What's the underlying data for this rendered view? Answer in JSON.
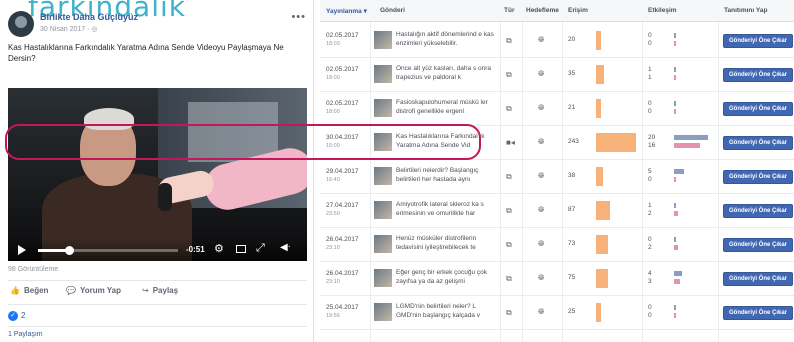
{
  "watermark": "farkındalık",
  "post": {
    "page_name": "Birlikte Daha Güçlüyüz",
    "date": "30 Nisan 2017 · ◎",
    "more": "•••",
    "text": "Kas Hastalıklarına Farkındalık Yaratma Adına Sende Videoyu Paylaşmaya Ne Dersin?",
    "video": {
      "time": "-0:51",
      "progress": 0.22,
      "icons": [
        "play-icon",
        "settings-icon",
        "screen-icon",
        "fullscreen-icon",
        "volume-icon"
      ]
    },
    "views": "98 Görüntüleme",
    "actions": [
      {
        "icon": "👍",
        "label": "Beğen"
      },
      {
        "icon": "💬",
        "label": "Yorum Yap"
      },
      {
        "icon": "↪",
        "label": "Paylaş"
      }
    ],
    "reactions_count": "2",
    "shares": "1 Paylaşım"
  },
  "insights": {
    "headers": {
      "date": "Yayınlanma ▾",
      "post": "Gönderi",
      "type": "Tür",
      "targeting": "Hedefleme",
      "reach": "Erişim",
      "engagement": "Etkileşim",
      "promote": "Tanıtımını Yap"
    },
    "rows": [
      {
        "date": "02.05.2017",
        "time": "18:03",
        "text": "Hastalığın aktif dönemlerind e kas enzimleri yükselebilir.",
        "type": "link-icon",
        "reach": "20",
        "reach_frac": 0.12,
        "eng": [
          "0",
          "0"
        ],
        "eng_frac": [
          0.0,
          0.0
        ],
        "button": "Gönderiyi Öne Çıkar"
      },
      {
        "date": "02.05.2017",
        "time": "18:00",
        "text": "Önce alt yüz kasları, daha s onra trapezius ve paldoral k",
        "type": "link-icon",
        "reach": "35",
        "reach_frac": 0.2,
        "eng": [
          "1",
          "1"
        ],
        "eng_frac": [
          0.05,
          0.05
        ],
        "button": "Gönderiyi Öne Çıkar"
      },
      {
        "date": "02.05.2017",
        "time": "18:00",
        "text": "Fasioskapulohumeral müskü ler distrofi genellikle ergenl",
        "type": "link-icon",
        "reach": "21",
        "reach_frac": 0.12,
        "eng": [
          "0",
          "0"
        ],
        "eng_frac": [
          0.0,
          0.0
        ],
        "button": "Gönderiyi Öne Çıkar"
      },
      {
        "date": "30.04.2017",
        "time": "15:00",
        "text": "Kas Hastalıklarına Farkındal ık Yaratma Adına Sende Vid",
        "type": "video-icon",
        "reach": "243",
        "reach_frac": 1.0,
        "eng": [
          "20",
          "16"
        ],
        "eng_frac": [
          0.85,
          0.65
        ],
        "button": "Gönderiyi Öne Çıkar"
      },
      {
        "date": "29.04.2017",
        "time": "16:40",
        "text": "Belirtileri nelerdir? Başlangıç belirtileri her hastada aynı",
        "type": "link-icon",
        "reach": "38",
        "reach_frac": 0.18,
        "eng": [
          "5",
          "0"
        ],
        "eng_frac": [
          0.25,
          0.0
        ],
        "button": "Gönderiyi Öne Çıkar"
      },
      {
        "date": "27.04.2017",
        "time": "23:50",
        "text": "Amiyotrofik lateral skleroz ka s erimesinin ve omurilikte har",
        "type": "link-icon",
        "reach": "87",
        "reach_frac": 0.36,
        "eng": [
          "1",
          "2"
        ],
        "eng_frac": [
          0.05,
          0.1
        ],
        "button": "Gönderiyi Öne Çıkar"
      },
      {
        "date": "26.04.2017",
        "time": "23:10",
        "text": "Henüz müsküler distrofilerin tedavisini iyileştirebilecek te",
        "type": "link-icon",
        "reach": "73",
        "reach_frac": 0.3,
        "eng": [
          "0",
          "2"
        ],
        "eng_frac": [
          0.0,
          0.1
        ],
        "button": "Gönderiyi Öne Çıkar"
      },
      {
        "date": "26.04.2017",
        "time": "23:10",
        "text": "Eğer genç bir erkek çocuğu çok zayıfsa ya da az gelişmi",
        "type": "link-icon",
        "reach": "75",
        "reach_frac": 0.31,
        "eng": [
          "4",
          "3"
        ],
        "eng_frac": [
          0.2,
          0.15
        ],
        "button": "Gönderiyi Öne Çıkar"
      },
      {
        "date": "25.04.2017",
        "time": "19:56",
        "text": "LGMD'nin belirtileri neler? L GMD'nin başlangıç kalçada v",
        "type": "link-icon",
        "reach": "25",
        "reach_frac": 0.13,
        "eng": [
          "0",
          "0"
        ],
        "eng_frac": [
          0.0,
          0.0
        ],
        "button": "Gönderiyi Öne Çıkar"
      }
    ],
    "highlighted_row": 3
  },
  "colors": {
    "link": "#365899",
    "boost_button": "#4267b2",
    "reach_bar": "#f7b27a",
    "eng_bar_a": "#8b9dc3",
    "eng_bar_b": "#e493a9",
    "highlight": "#c2185b"
  }
}
